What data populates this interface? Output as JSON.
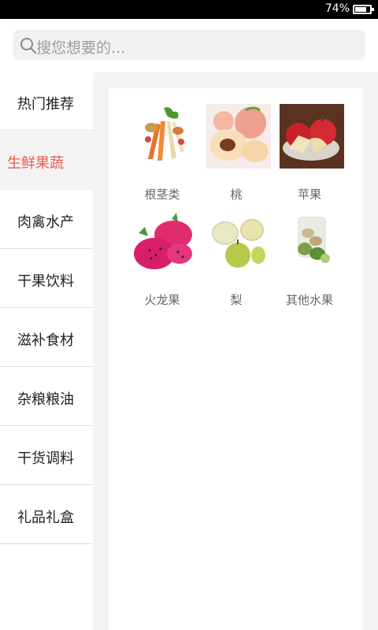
{
  "status_bar": {
    "battery_percent": "74%"
  },
  "search": {
    "placeholder": "搜您想要的..."
  },
  "sidebar": {
    "items": [
      {
        "label": "热门推荐",
        "active": false
      },
      {
        "label": "生鲜果蔬",
        "active": true
      },
      {
        "label": "肉禽水产",
        "active": false
      },
      {
        "label": "干果饮料",
        "active": false
      },
      {
        "label": "滋补食材",
        "active": false
      },
      {
        "label": "杂粮粮油",
        "active": false
      },
      {
        "label": "干货调料",
        "active": false
      },
      {
        "label": "礼品礼盒",
        "active": false
      }
    ]
  },
  "categories": [
    {
      "name": "根茎类",
      "icon": "root-vegetables-image"
    },
    {
      "name": "桃",
      "icon": "peach-image"
    },
    {
      "name": "苹果",
      "icon": "apple-image"
    },
    {
      "name": "火龙果",
      "icon": "dragon-fruit-image"
    },
    {
      "name": "梨",
      "icon": "pear-image"
    },
    {
      "name": "其他水果",
      "icon": "other-fruit-image"
    }
  ],
  "colors": {
    "accent": "#e95d4b",
    "background": "#f3f3f3"
  }
}
